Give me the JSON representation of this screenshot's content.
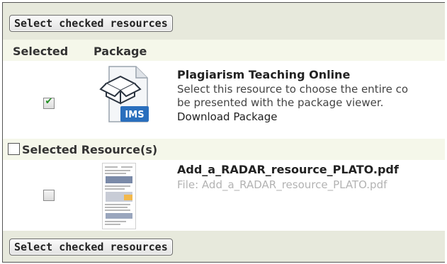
{
  "buttons": {
    "top_label": "Select checked resources",
    "bottom_label": "Select checked resources"
  },
  "table_header": {
    "selected": "Selected",
    "package": "Package"
  },
  "package": {
    "title": "Plagiarism Teaching Online",
    "description_line1": "Select this resource to choose the entire co",
    "description_line2": "be presented with the package viewer.",
    "download_link": "Download Package",
    "checked": true,
    "icon": "ims-package-icon",
    "icon_label": "IMS"
  },
  "resources_section": {
    "label": "Selected Resource(s)",
    "checked": false
  },
  "resources": [
    {
      "title": "Add_a_RADAR_resource_PLATO.pdf",
      "file_line": "File: Add_a_RADAR_resource_PLATO.pdf",
      "checked": false,
      "icon": "pdf-thumbnail"
    }
  ],
  "colors": {
    "bar_bg": "#e7e9dc",
    "header_bg": "#f5f7ea",
    "check_green": "#1f8f1f",
    "ims_blue": "#2a6fbd"
  }
}
